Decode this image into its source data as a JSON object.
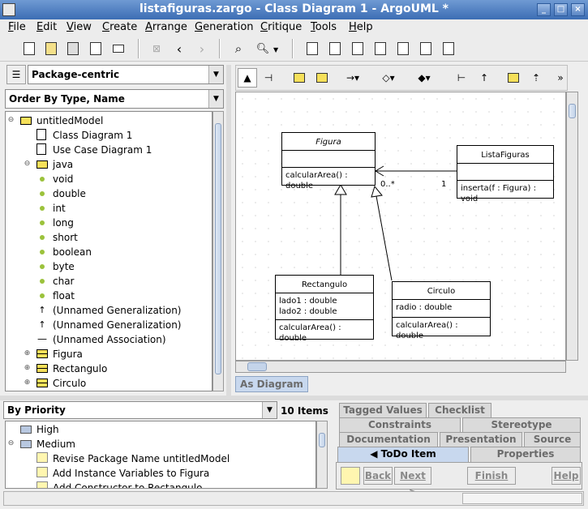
{
  "window": {
    "title": "listafiguras.zargo - Class Diagram 1 - ArgoUML *"
  },
  "menu": [
    "File",
    "Edit",
    "View",
    "Create",
    "Arrange",
    "Generation",
    "Critique",
    "Tools",
    "Help"
  ],
  "explorer": {
    "perspective": "Package-centric",
    "order": "Order By Type, Name",
    "tree": [
      {
        "label": "untitledModel",
        "icon": "package-icon",
        "indent": 0,
        "toggle": "minus"
      },
      {
        "label": "Class Diagram 1",
        "icon": "class-diagram-icon",
        "indent": 1
      },
      {
        "label": "Use Case Diagram 1",
        "icon": "usecase-diagram-icon",
        "indent": 1
      },
      {
        "label": "java",
        "icon": "package-icon",
        "indent": 1,
        "toggle": "minus"
      },
      {
        "label": "void",
        "icon": "datatype-icon",
        "indent": 1
      },
      {
        "label": "double",
        "icon": "datatype-icon",
        "indent": 1
      },
      {
        "label": "int",
        "icon": "datatype-icon",
        "indent": 1
      },
      {
        "label": "long",
        "icon": "datatype-icon",
        "indent": 1
      },
      {
        "label": "short",
        "icon": "datatype-icon",
        "indent": 1
      },
      {
        "label": "boolean",
        "icon": "datatype-icon",
        "indent": 1
      },
      {
        "label": "byte",
        "icon": "datatype-icon",
        "indent": 1
      },
      {
        "label": "char",
        "icon": "datatype-icon",
        "indent": 1
      },
      {
        "label": "float",
        "icon": "datatype-icon",
        "indent": 1
      },
      {
        "label": "(Unnamed Generalization)",
        "icon": "generalization-icon",
        "indent": 1
      },
      {
        "label": "(Unnamed Generalization)",
        "icon": "generalization-icon",
        "indent": 1
      },
      {
        "label": "(Unnamed Association)",
        "icon": "association-icon",
        "indent": 1
      },
      {
        "label": "Figura",
        "icon": "class-icon",
        "indent": 1,
        "toggle": "plus"
      },
      {
        "label": "Rectangulo",
        "icon": "class-icon",
        "indent": 1,
        "toggle": "plus"
      },
      {
        "label": "Circulo",
        "icon": "class-icon",
        "indent": 1,
        "toggle": "plus"
      }
    ]
  },
  "diagram": {
    "tab": "As Diagram",
    "classes": {
      "figura": {
        "name": "Figura",
        "attrs": "",
        "ops": "calcularArea() : double"
      },
      "listafiguras": {
        "name": "ListaFiguras",
        "attrs": "",
        "ops": "inserta(f : Figura) : void"
      },
      "rectangulo": {
        "name": "Rectangulo",
        "attrs": "lado1 : double\nlado2 : double",
        "ops": "calcularArea() : double"
      },
      "circulo": {
        "name": "Circulo",
        "attrs": "radio : double",
        "ops": "calcularArea() : double"
      }
    },
    "multiplicity_many": "0..*",
    "multiplicity_one": "1"
  },
  "todo": {
    "sort": "By Priority",
    "count": "10 Items",
    "items": [
      {
        "label": "High",
        "icon": "folder-icon",
        "indent": 0
      },
      {
        "label": "Medium",
        "icon": "folder-icon",
        "indent": 0,
        "toggle": "minus"
      },
      {
        "label": "Revise Package Name untitledModel",
        "icon": "note-icon",
        "indent": 1
      },
      {
        "label": "Add Instance Variables to Figura",
        "icon": "note-icon",
        "indent": 1
      },
      {
        "label": "Add Constructor to Rectangulo",
        "icon": "note-icon",
        "indent": 1
      }
    ]
  },
  "details": {
    "tabs_row1": [
      "Tagged Values",
      "Checklist"
    ],
    "tabs_row2": [
      "Constraints",
      "Stereotype"
    ],
    "tabs_row3": [
      "Documentation",
      "Presentation",
      "Source"
    ],
    "tabs_row4": [
      "◀ ToDo Item",
      "Properties"
    ],
    "buttons": {
      "back": "Back",
      "next": "Next >",
      "finish": "Finish",
      "help": "Help"
    }
  },
  "colors": {
    "title_bar": "#4a7bc0",
    "selected_tab": "#c8d8ee",
    "class_fill": "#ffffff"
  }
}
